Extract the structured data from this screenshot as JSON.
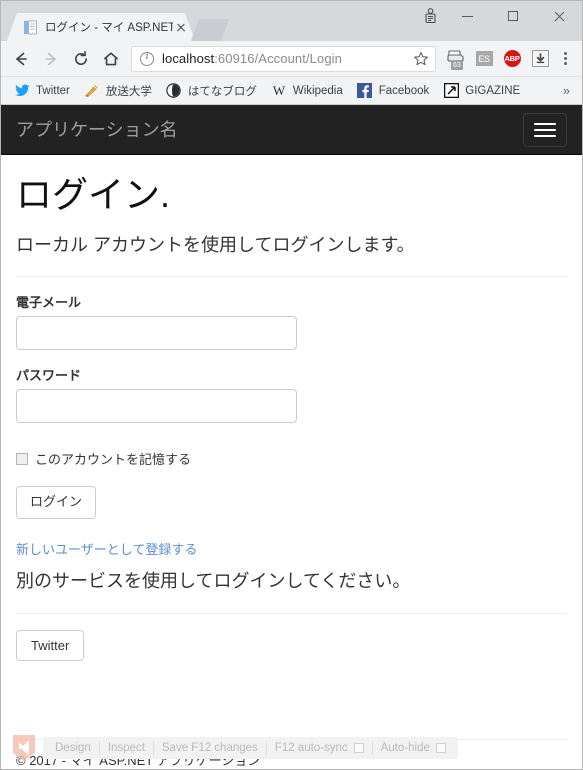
{
  "browser": {
    "tab": {
      "title": "ログイン - マイ ASP.NET アプ",
      "favicon_icon": "document-icon",
      "close_icon": "close-icon"
    },
    "window_controls": {
      "profile_icon": "profile-person-icon",
      "minimize_icon": "minimize-icon",
      "maximize_icon": "maximize-icon",
      "close_icon": "close-icon"
    },
    "toolbar": {
      "back_icon": "back-arrow-icon",
      "forward_icon": "forward-arrow-icon",
      "reload_icon": "reload-icon",
      "home_icon": "home-icon",
      "site_info_icon": "info-circle-icon",
      "url_host": "localhost",
      "url_rest": ":60916/Account/Login",
      "url_full": "localhost:60916/Account/Login",
      "bookmark_star_icon": "star-icon",
      "extensions": [
        {
          "name": "printer-extension-icon",
          "badge": "63"
        },
        {
          "name": "es-extension-icon",
          "label": "ES"
        },
        {
          "name": "adblock-plus-icon",
          "label": "ABP"
        },
        {
          "name": "download-extension-icon"
        }
      ],
      "menu_icon": "kebab-menu-icon"
    },
    "bookmarks": [
      {
        "label": "Twitter",
        "icon": "twitter-bird-icon"
      },
      {
        "label": "放送大学",
        "icon": "houso-daigaku-icon"
      },
      {
        "label": "はてなブログ",
        "icon": "hatena-blog-icon"
      },
      {
        "label": "Wikipedia",
        "icon": "wikipedia-w-icon"
      },
      {
        "label": "Facebook",
        "icon": "facebook-f-icon"
      },
      {
        "label": "GIGAZINE",
        "icon": "gigazine-icon"
      }
    ],
    "bookmarks_overflow": "»"
  },
  "site": {
    "navbar": {
      "brand": "アプリケーション名",
      "toggle_icon": "hamburger-menu-icon"
    },
    "login": {
      "heading": "ログイン.",
      "subtitle": "ローカル アカウントを使用してログインします。",
      "email_label": "電子メール",
      "email_value": "",
      "password_label": "パスワード",
      "password_value": "",
      "remember_label": "このアカウントを記憶する",
      "remember_checked": false,
      "submit_label": "ログイン",
      "register_link": "新しいユーザーとして登録する"
    },
    "external": {
      "heading": "別のサービスを使用してログインしてください。",
      "providers": [
        {
          "label": "Twitter"
        }
      ]
    },
    "footer": {
      "copyright": "© 2017 - マイ ASP.NET アプリケーション"
    }
  },
  "browser_link": {
    "vs_logo_icon": "visual-studio-shield-icon",
    "items": [
      {
        "label": "Design",
        "checkbox": false
      },
      {
        "label": "Inspect",
        "checkbox": false
      },
      {
        "label": "Save F12 changes",
        "checkbox": false
      },
      {
        "label": "F12 auto-sync",
        "checkbox": true
      },
      {
        "label": "Auto-hide",
        "checkbox": true
      }
    ]
  },
  "colors": {
    "navbar_bg": "#222222",
    "brand_text": "#9d9d9d",
    "link": "#5b8fd0",
    "adblock_red": "#d71717"
  }
}
